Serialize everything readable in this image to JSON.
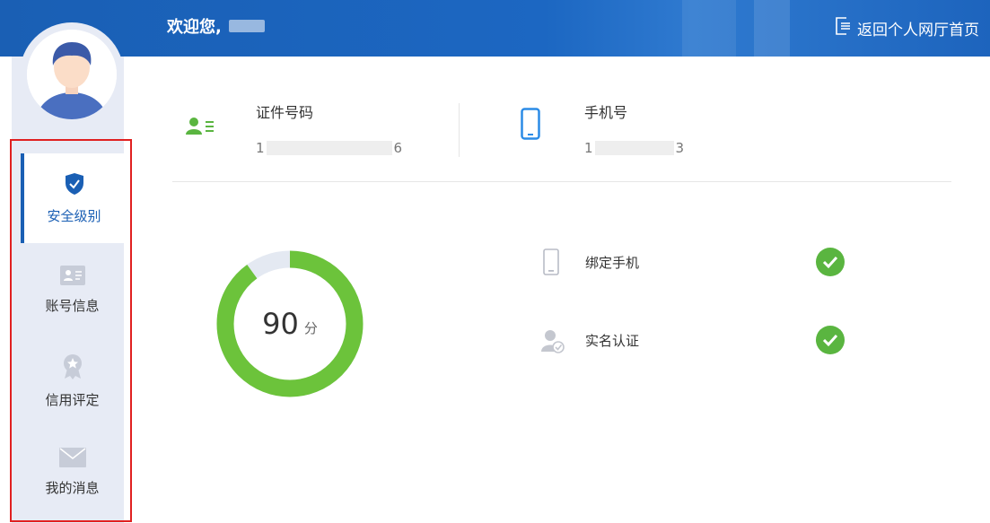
{
  "header": {
    "welcome_text": "欢迎您,",
    "return_label": "返回个人网厅首页"
  },
  "sidebar": {
    "items": [
      {
        "label": "安全级别",
        "icon": "shield-check-icon",
        "active": true
      },
      {
        "label": "账号信息",
        "icon": "id-card-icon",
        "active": false
      },
      {
        "label": "信用评定",
        "icon": "badge-icon",
        "active": false
      },
      {
        "label": "我的消息",
        "icon": "envelope-icon",
        "active": false
      }
    ]
  },
  "profile": {
    "id_label": "证件号码",
    "id_value_start": "1",
    "id_value_end": "6",
    "phone_label": "手机号",
    "phone_value_start": "1",
    "phone_value_end": "3"
  },
  "security": {
    "score": "90",
    "score_unit": "分",
    "score_fraction": 0.9,
    "checks": [
      {
        "label": "绑定手机",
        "icon": "phone-icon",
        "status": "ok"
      },
      {
        "label": "实名认证",
        "icon": "user-verified-icon",
        "status": "ok"
      }
    ]
  },
  "colors": {
    "header_blue": "#1a5fb4",
    "accent_green": "#6cc33b",
    "check_green": "#5ab540",
    "sidebar_bg": "#e7ebf5",
    "highlight_red": "#e02020"
  }
}
